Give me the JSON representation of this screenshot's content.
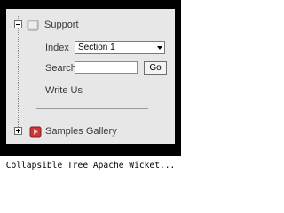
{
  "tree": {
    "support_label": "Support",
    "index_label": "Index",
    "index_selected": "Section 1",
    "search_label": "Search",
    "search_value": "",
    "go_label": "Go",
    "write_us_label": "Write Us",
    "samples_label": "Samples Gallery"
  },
  "caption": "Collapsible Tree Apache Wicket..."
}
